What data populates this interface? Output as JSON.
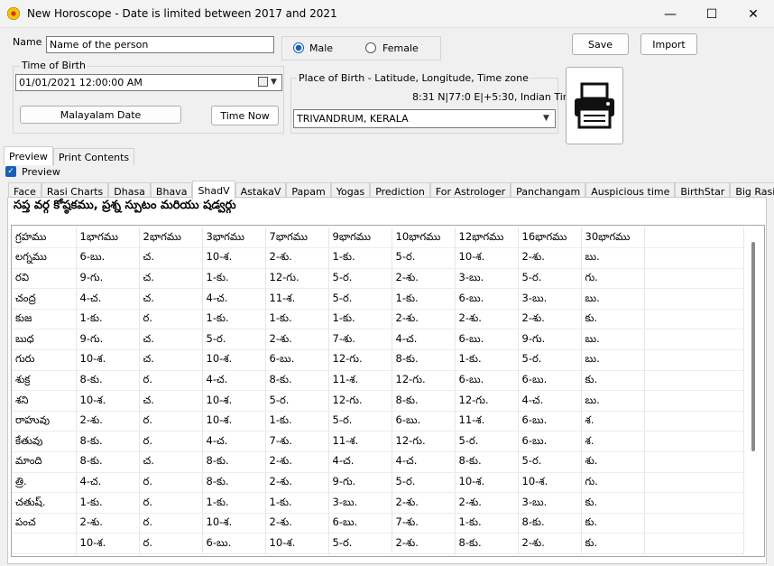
{
  "window": {
    "title": "New Horoscope - Date is limited between 2017 and 2021",
    "minimize_glyph": "—",
    "maximize_glyph": "☐",
    "close_glyph": "✕"
  },
  "form": {
    "name_label": "Name",
    "name_value": "Name of the person",
    "gender_male": "Male",
    "gender_female": "Female",
    "gender_selected": "Male",
    "save_label": "Save",
    "import_label": "Import",
    "time_of_birth_label": "Time of Birth",
    "time_of_birth_value": "01/01/2021  12:00:00 AM",
    "malayalam_date_label": "Malayalam Date",
    "time_now_label": "Time Now",
    "place_label": "Place of Birth - Latitude, Longitude, Time zone",
    "place_coords": "8:31 N|77:0 E|+5:30, Indian Time",
    "place_value": "TRIVANDRUM, KERALA",
    "print_icon": "printer-icon"
  },
  "view_tabs": [
    "Preview",
    "Print Contents"
  ],
  "preview_checkbox": {
    "label": "Preview",
    "checked": true
  },
  "content_tabs": [
    "Face",
    "Rasi Charts",
    "Dhasa",
    "Bhava",
    "ShadV",
    "AstakaV",
    "Papam",
    "Yogas",
    "Prediction",
    "For Astrologer",
    "Panchangam",
    "Auspicious time",
    "BirthStar",
    "Big Rasi"
  ],
  "active_content_tab": "ShadV",
  "heading": "సప్త వర్గ కోష్ఠకము, ప్రశ్న స్పుటం మరియు షడ్వర్గు",
  "table": {
    "headers": [
      "గ్రహము",
      "1భాగము",
      "2భాగము",
      "3భాగము",
      "7భాగము",
      "9భాగము",
      "10భాగము",
      "12భాగము",
      "16భాగము",
      "30భాగము"
    ],
    "rows": [
      [
        "లగ్నము",
        "6-బు.",
        "చ.",
        "10-శ.",
        "2-శు.",
        "1-కు.",
        "5-ర.",
        "10-శ.",
        "2-శు.",
        "బు."
      ],
      [
        "రవి",
        "9-గు.",
        "చ.",
        "1-కు.",
        "12-గు.",
        "5-ర.",
        "2-శు.",
        "3-బు.",
        "5-ర.",
        "గు."
      ],
      [
        "చంద్ర",
        "4-చ.",
        "చ.",
        "4-చ.",
        "11-శ.",
        "5-ర.",
        "1-కు.",
        "6-బు.",
        "3-బు.",
        "బు."
      ],
      [
        "కుజ",
        "1-కు.",
        "ర.",
        "1-కు.",
        "1-కు.",
        "1-కు.",
        "2-శు.",
        "2-శు.",
        "2-శు.",
        "కు."
      ],
      [
        "బుధ",
        "9-గు.",
        "చ.",
        "5-ర.",
        "2-శు.",
        "7-శు.",
        "4-చ.",
        "6-బు.",
        "9-గు.",
        "బు."
      ],
      [
        "గురు",
        "10-శ.",
        "చ.",
        "10-శ.",
        "6-బు.",
        "12-గు.",
        "8-కు.",
        "1-కు.",
        "5-ర.",
        "బు."
      ],
      [
        "శుక్ర",
        "8-కు.",
        "ర.",
        "4-చ.",
        "8-కు.",
        "11-శ.",
        "12-గు.",
        "6-బు.",
        "6-బు.",
        "కు."
      ],
      [
        "శని",
        "10-శ.",
        "చ.",
        "10-శ.",
        "5-ర.",
        "12-గు.",
        "8-కు.",
        "12-గు.",
        "4-చ.",
        "బు."
      ],
      [
        "రాహువు",
        "2-శు.",
        "ర.",
        "10-శ.",
        "1-కు.",
        "5-ర.",
        "6-బు.",
        "11-శ.",
        "6-బు.",
        "శ."
      ],
      [
        "కేతువు",
        "8-కు.",
        "ర.",
        "4-చ.",
        "7-శు.",
        "11-శ.",
        "12-గు.",
        "5-ర.",
        "6-బు.",
        "శ."
      ],
      [
        "మాంది",
        "8-కు.",
        "చ.",
        "8-కు.",
        "2-శు.",
        "4-చ.",
        "4-చ.",
        "8-కు.",
        "5-ర.",
        "శు."
      ],
      [
        "త్రి.",
        "4-చ.",
        "ర.",
        "8-కు.",
        "2-శు.",
        "9-గు.",
        "5-ర.",
        "10-శ.",
        "10-శ.",
        "గు."
      ],
      [
        "చతుష్.",
        "1-కు.",
        "ర.",
        "1-కు.",
        "1-కు.",
        "3-బు.",
        "2-శు.",
        "2-శు.",
        "3-బు.",
        "కు."
      ],
      [
        "పంచ",
        "2-శు.",
        "ర.",
        "10-శ.",
        "2-శు.",
        "6-బు.",
        "7-శు.",
        "1-కు.",
        "8-కు.",
        "కు."
      ],
      [
        "",
        "10-శ.",
        "ర.",
        "6-బు.",
        "10-శ.",
        "5-ర.",
        "2-శు.",
        "8-కు.",
        "2-శు.",
        "కు."
      ]
    ]
  }
}
